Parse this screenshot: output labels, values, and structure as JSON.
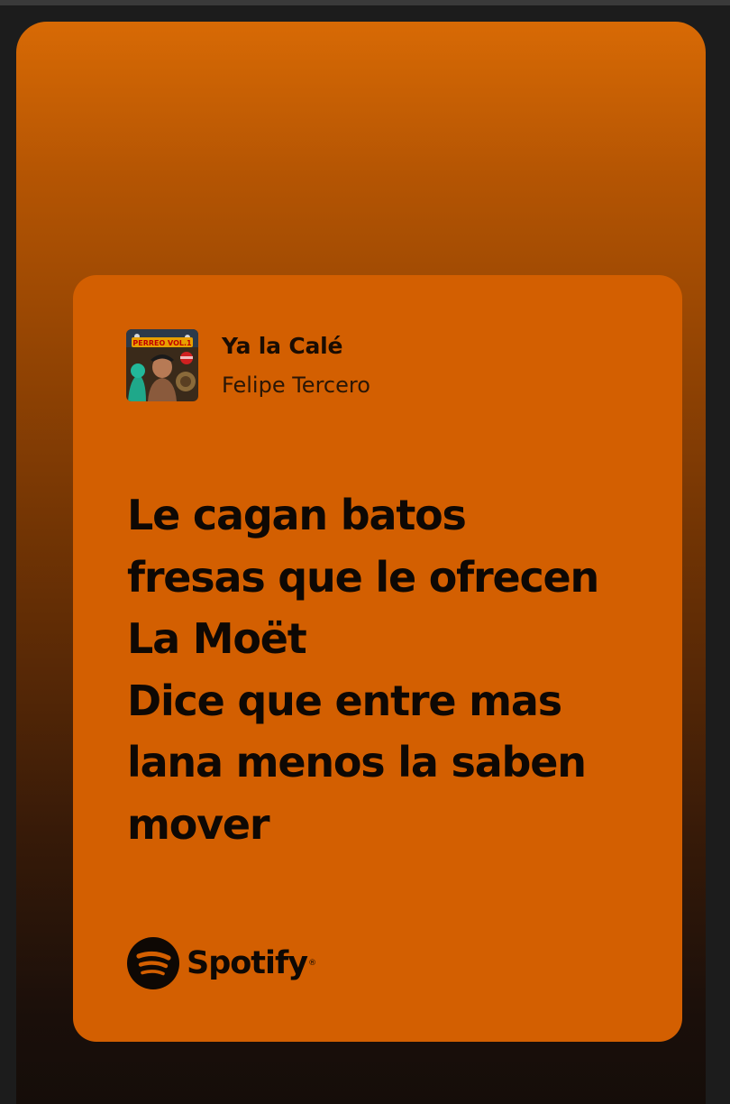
{
  "colors": {
    "card_background": "#d35f01",
    "text": "#0e0804",
    "outer_background": "#1c1c1c"
  },
  "track": {
    "cover_art_text": "PERREO VOL.1",
    "title": "Ya la Calé",
    "artist": "Felipe Tercero"
  },
  "lyrics": [
    "Le cagan batos",
    "fresas que le ofrecen",
    "La Moët",
    "Dice que entre mas",
    "lana menos la saben",
    "mover"
  ],
  "brand": {
    "icon": "spotify-icon",
    "name": "Spotify",
    "trademark": "®"
  }
}
